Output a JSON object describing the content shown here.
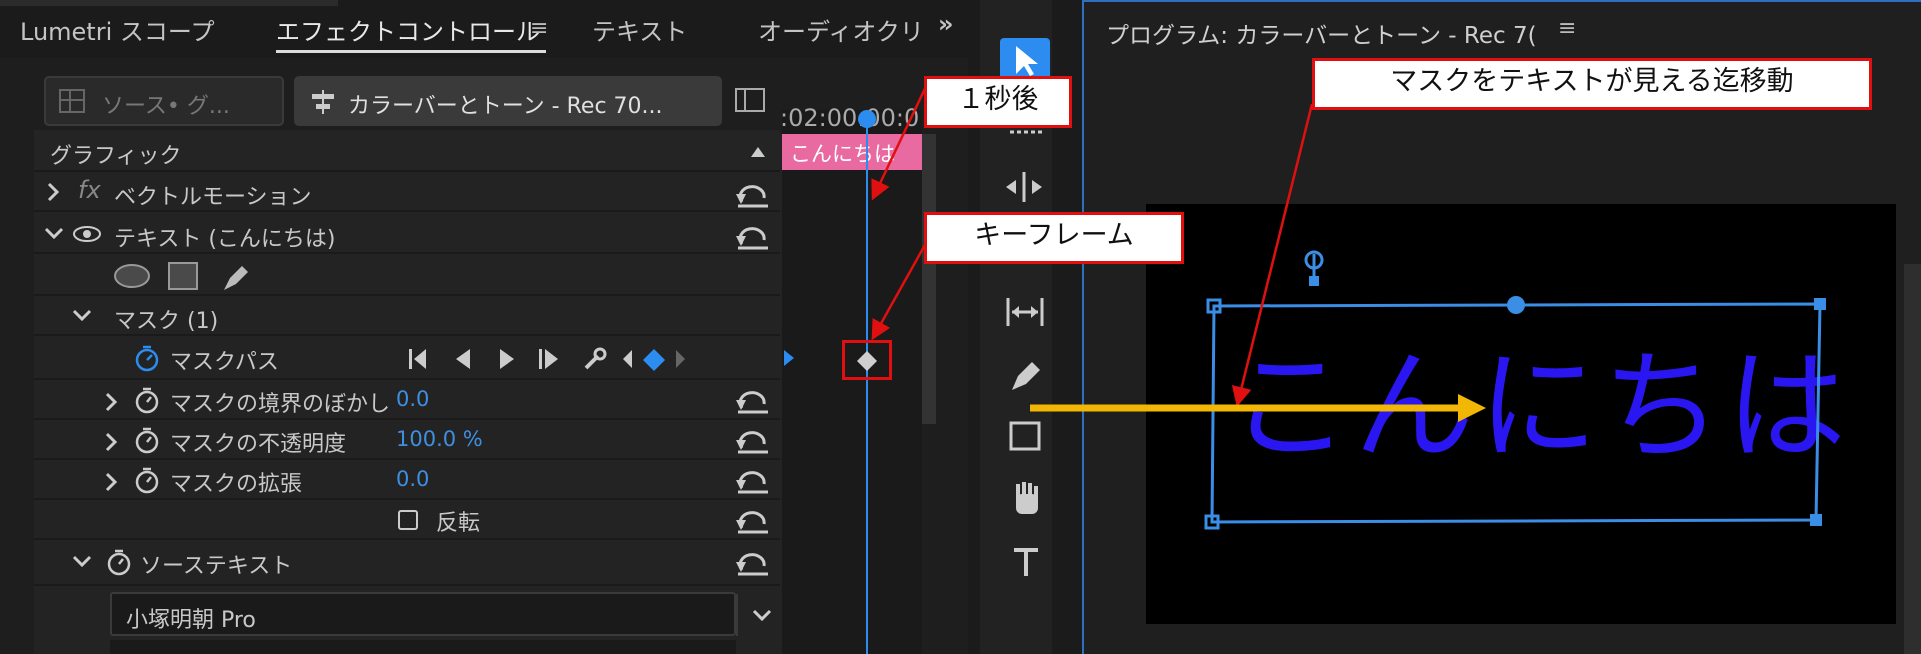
{
  "tabs": {
    "lumetri": "Lumetri スコープ",
    "effect_controls": "エフェクトコントロール",
    "text": "テキスト",
    "audio_clip": "オーディオクリ",
    "overflow": "»"
  },
  "source": {
    "source_pill": "ソース• グ...",
    "active_clip": "カラーバーとトーン - Rec 70..."
  },
  "timeline": {
    "timecode": ":02:00:00:0",
    "clip_label": "こんにちは"
  },
  "properties": {
    "section": "グラフィック",
    "vector_motion": "ベクトルモーション",
    "text_layer": "テキスト (こんにちは)",
    "mask": "マスク (1)",
    "mask_path": "マスクパス",
    "mask_feather_label": "マスクの境界のぼかし",
    "mask_feather_value": "0.0",
    "mask_opacity_label": "マスクの不透明度",
    "mask_opacity_value": "100.0 %",
    "mask_expansion_label": "マスクの拡張",
    "mask_expansion_value": "0.0",
    "invert_label": "反転",
    "source_text": "ソーステキスト",
    "font_name": "小塚明朝 Pro"
  },
  "program": {
    "title": "プログラム: カラーバーとトーン - Rec 7(",
    "preview_text": "こんにちは"
  },
  "callouts": {
    "one_second": "１秒後",
    "keyframe": "キーフレーム",
    "move_mask": "マスクをテキストが見える迄移動"
  },
  "colors": {
    "accent_blue": "#2d8cf0",
    "clip_pink": "#e86aa0",
    "preview_text": "#2a16f0",
    "callout_red": "#e01010",
    "arrow_yellow": "#f2b705"
  },
  "icons": [
    "ellipse-icon",
    "rectangle-icon",
    "pen-icon",
    "stopwatch-icon",
    "reset-icon",
    "wrench-icon",
    "keyframe-diamond-icon",
    "selection-arrow-icon",
    "move-icon",
    "track-select-icon",
    "pen-tool-icon",
    "hand-icon",
    "type-tool-icon"
  ]
}
